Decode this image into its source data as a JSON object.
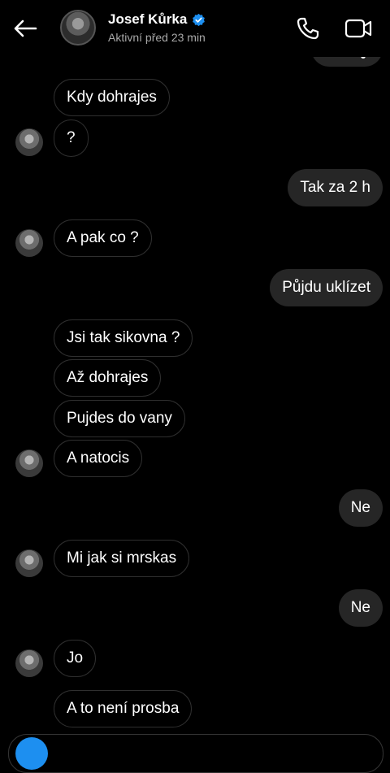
{
  "header": {
    "back_icon": "back-arrow-icon",
    "contact_name": "Josef Kůrka",
    "verified_icon": "verified-badge-icon",
    "status": "Aktivní před 23 min",
    "call_icon": "phone-icon",
    "video_icon": "video-camera-icon",
    "verified_color": "#1d8ff0"
  },
  "messages": [
    {
      "dir": "in",
      "text": "Kdy dohrajes"
    },
    {
      "dir": "in",
      "text": "?"
    },
    {
      "dir": "out",
      "text": "Tak za 2 h"
    },
    {
      "dir": "in",
      "text": "A pak co ?"
    },
    {
      "dir": "out",
      "text": "Půjdu uklízet"
    },
    {
      "dir": "in",
      "text": "Jsi tak sikovna ?"
    },
    {
      "dir": "in",
      "text": "Až dohrajes"
    },
    {
      "dir": "in",
      "text": "Pujdes do vany"
    },
    {
      "dir": "in",
      "text": "A natocis"
    },
    {
      "dir": "out",
      "text": "Ne"
    },
    {
      "dir": "in",
      "text": "Mi jak si mrskas"
    },
    {
      "dir": "out",
      "text": "Ne"
    },
    {
      "dir": "in",
      "text": "Jo"
    },
    {
      "dir": "in",
      "text": "A to není prosba"
    }
  ],
  "colors": {
    "background": "#000000",
    "outgoing_bubble": "#262626",
    "incoming_border": "#2f2f2f",
    "status_text": "#a8a8a8"
  }
}
